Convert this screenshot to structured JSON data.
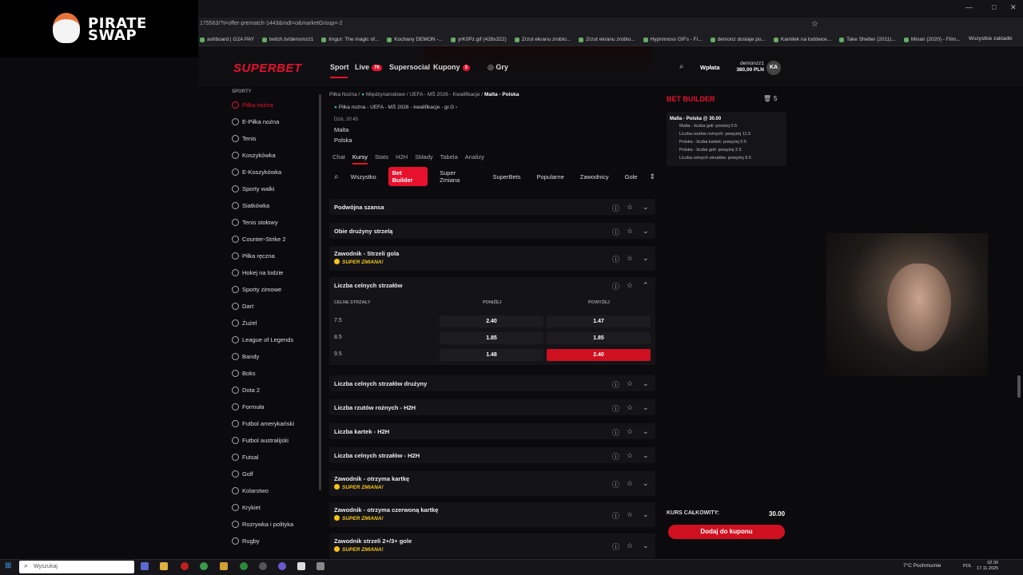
{
  "browser": {
    "url_fragment": "175563/?t=offer-prematch-1443&mdt=o&marketGroup=-2",
    "bookmarks": [
      "ashboard | G2A PAY",
      "twitch.tv/demonzz1",
      "Imgur: The magic of...",
      "Kochany DEMON -...",
      "yrK0Pz.gif (428x322)",
      "Zrzut ekranu zrobio...",
      "Zrzut ekranu zrobio...",
      "Hypnnnoss GIFs - Fi...",
      "demonz dostaje po...",
      "Kamilek na lodówce...",
      "Take Shelter (2011)...",
      "Minari (2020) - Film..."
    ],
    "all_bookmarks": "Wszystkie zakładki"
  },
  "overlay": {
    "logo_line1": "PIRATE",
    "logo_line2": "SWAP"
  },
  "header": {
    "brand": "SUPERBET",
    "nav": [
      {
        "label": "Sport",
        "badge": ""
      },
      {
        "label": "Live",
        "badge": "76"
      },
      {
        "label": "Supersocial",
        "badge": ""
      },
      {
        "label": "Kupony",
        "badge": "3"
      },
      {
        "label": "Gry",
        "badge": ""
      }
    ],
    "deposit": "Wpłata",
    "username": "demonzz1",
    "balance": "380,00 PLN",
    "avatar_initials": "KA"
  },
  "sidebar": {
    "title": "SPORTY",
    "items": [
      "Piłka nożna",
      "E-Piłka nożna",
      "Tenis",
      "Koszykówka",
      "E-Koszykówka",
      "Sporty walki",
      "Siatkówka",
      "Tenis stołowy",
      "Counter-Strike 2",
      "Piłka ręczna",
      "Hokej na lodzie",
      "Sporty zimowe",
      "Dart",
      "Żużel",
      "League of Legends",
      "Bandy",
      "Boks",
      "Dota 2",
      "Formuła",
      "Futbol amerykański",
      "Futbol australijski",
      "Futsal",
      "Golf",
      "Kolarstwo",
      "Krykiet",
      "Rozrywka i polityka",
      "Rugby"
    ]
  },
  "match": {
    "breadcrumb": [
      "Piłka Nożna",
      "Międzynarodowe",
      "UEFA - MŚ 2026 - Kwalifikacje",
      "Malta - Polska"
    ],
    "subcrumb": "Piłka nożna - UEFA - MŚ 2026 - kwalifikacje - gr.G",
    "time": "Dziś, 20:45",
    "home": "Malta",
    "away": "Polska",
    "tabs": [
      "Chat",
      "Kursy",
      "Stats",
      "H2H",
      "Składy",
      "Tabela",
      "Analizy"
    ],
    "filters": [
      "Wszystko",
      "Bet Builder",
      "Super Zmiana",
      "SuperBets",
      "Popularne",
      "Zawodnicy",
      "Gole"
    ]
  },
  "markets": [
    {
      "title": "Podwójna szansa",
      "super": ""
    },
    {
      "title": "Obie drużyny strzelą",
      "super": ""
    },
    {
      "title": "Zawodnik - Strzeli gola",
      "super": "SUPER ZMIANA!"
    },
    {
      "title": "Liczba celnych strzałów",
      "super": ""
    },
    {
      "title": "Liczba celnych strzałów drużyny",
      "super": ""
    },
    {
      "title": "Liczba rzutów rożnych - H2H",
      "super": ""
    },
    {
      "title": "Liczba kartek - H2H",
      "super": ""
    },
    {
      "title": "Liczba celnych strzałów - H2H",
      "super": ""
    },
    {
      "title": "Zawodnik - otrzyma kartkę",
      "super": "SUPER ZMIANA!"
    },
    {
      "title": "Zawodnik - otrzyma czerwoną kartkę",
      "super": "SUPER ZMIANA!"
    },
    {
      "title": "Zawodnik strzeli 2+/3+ gole",
      "super": "SUPER ZMIANA!"
    }
  ],
  "expanded": {
    "col_line": "CELNE STRZAŁY",
    "col_under": "PONIŻEJ",
    "col_over": "POWYŻEJ",
    "rows": [
      {
        "line": "7.5",
        "under": "2.40",
        "over": "1.47"
      },
      {
        "line": "8.5",
        "under": "1.85",
        "over": "1.85"
      },
      {
        "line": "9.5",
        "under": "1.48",
        "over": "2.40"
      }
    ]
  },
  "betbuilder": {
    "title": "BET BUILDER",
    "count": "5",
    "match": "Malta - Polska @ 30.00",
    "legs": [
      "Malta - liczba goli: poniżej 0.5",
      "Liczba rzutów rożnych: powyżej 11.5",
      "Polska - liczba kartek: powyżej 0.5",
      "Polska - liczba goli: powyżej 2.5",
      "Liczba celnych strzałów: powyżej 9.5"
    ],
    "total_label": "KURS CAŁKOWITY:",
    "total_value": "30.00",
    "add_button": "Dodaj do kuponu"
  },
  "taskbar": {
    "search": "Wyszukaj",
    "weather": "7°C  Pochmurnie",
    "lang": "POL",
    "time": "02:30",
    "date": "17.11.2025"
  },
  "colors": {
    "accent": "#e8112d",
    "super": "#f5c518",
    "background": "#0b0b0e"
  }
}
